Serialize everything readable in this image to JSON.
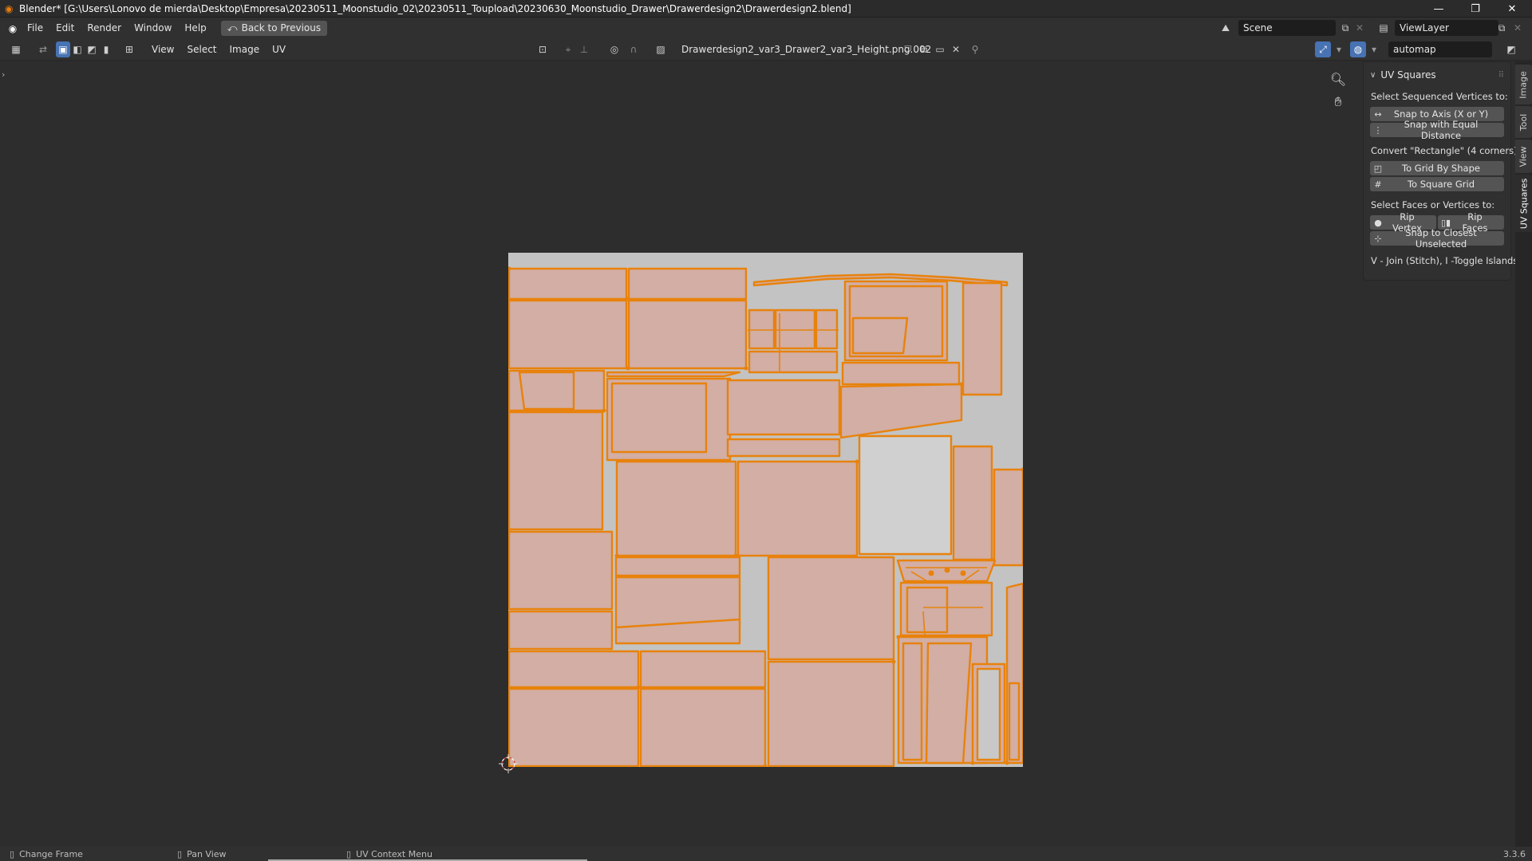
{
  "window": {
    "title": "Blender* [G:\\Users\\Lonovo de mierda\\Desktop\\Empresa\\20230511_Moonstudio_02\\20230511_Toupload\\20230630_Moonstudio_Drawer\\Drawerdesign2\\Drawerdesign2.blend]",
    "minimize": "—",
    "restore": "❐",
    "close": "✕"
  },
  "menubar": {
    "items": [
      "File",
      "Edit",
      "Render",
      "Window",
      "Help"
    ],
    "back_button": "Back to Previous",
    "scene": "Scene",
    "view_layer": "ViewLayer"
  },
  "editor_header": {
    "menus": [
      "View",
      "Select",
      "Image",
      "UV"
    ],
    "image_name": "Drawerdesign2_var3_Drawer2_var3_Height.png.002",
    "uv_map": "automap"
  },
  "uv_squares_panel": {
    "title": "UV Squares",
    "label_sequenced": "Select Sequenced Vertices to:",
    "snap_axis": "Snap to Axis (X or Y)",
    "snap_equal": "Snap with Equal Distance",
    "label_rectangle": "Convert \"Rectangle\" (4 corners):",
    "grid_shape": "To Grid By Shape",
    "square_grid": "To Square Grid",
    "label_faces": "Select Faces or Vertices to:",
    "rip_vertex": "Rip Vertex",
    "rip_faces": "Rip Faces",
    "snap_closest": "Snap to Closest Unselected",
    "hint": "V - Join (Stitch), I -Toggle Islands"
  },
  "side_tabs": [
    "Image",
    "Tool",
    "View",
    "UV Squares"
  ],
  "statusbar": {
    "change_frame": "Change Frame",
    "pan_view": "Pan View",
    "context_menu": "UV Context Menu",
    "version": "3.3.6"
  },
  "colors": {
    "uv_fill": "#d2aea4",
    "uv_edge": "#e8820c",
    "image_bg": "#c3c3c3",
    "accent": "#4772b3"
  }
}
